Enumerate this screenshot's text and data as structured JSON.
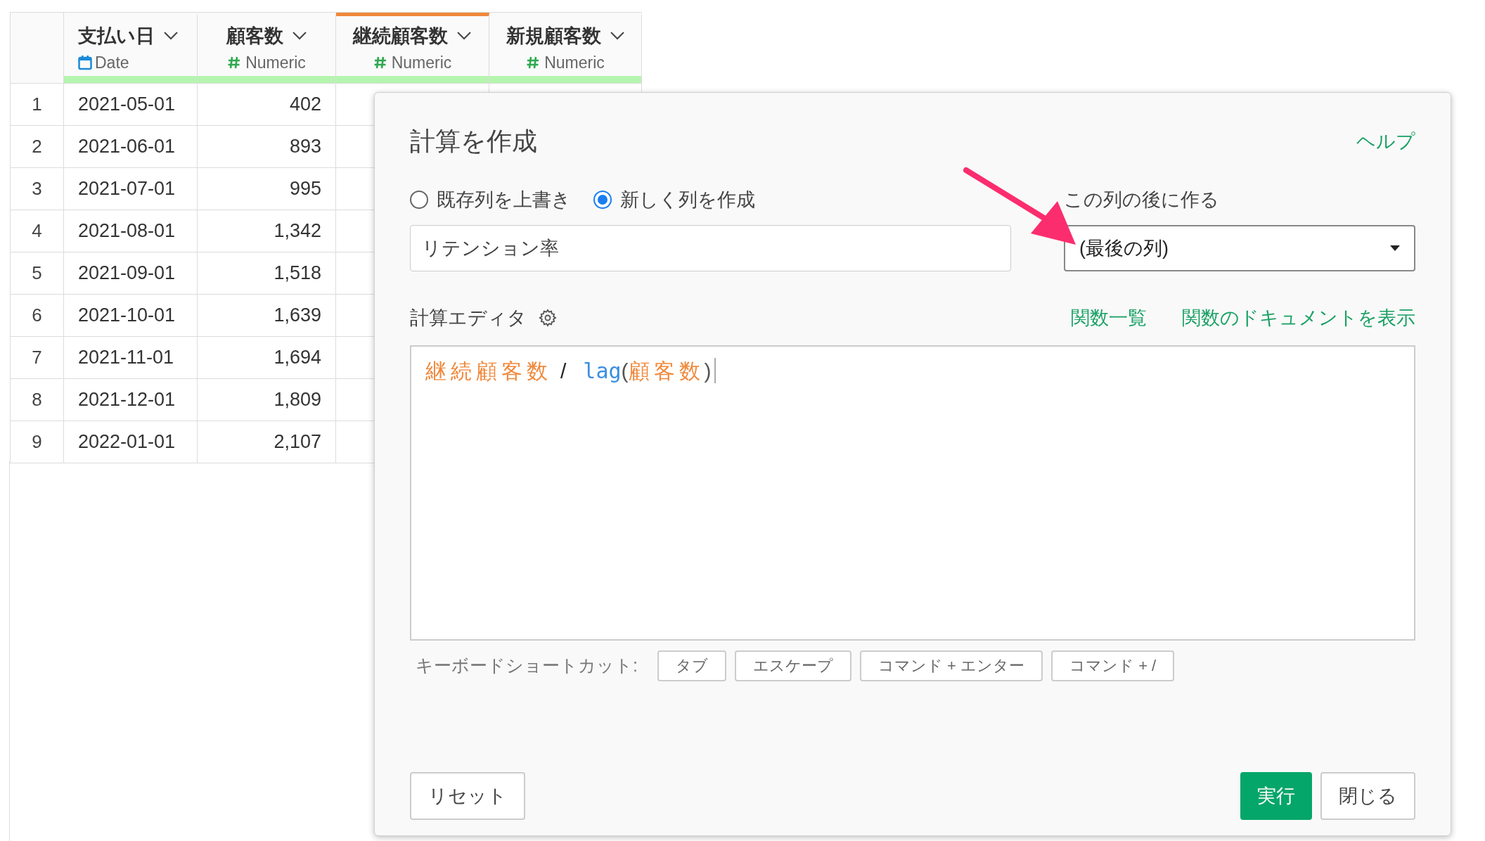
{
  "table": {
    "columns": [
      {
        "name": "支払い日",
        "type": "Date",
        "kind": "date",
        "selected": false
      },
      {
        "name": "顧客数",
        "type": "Numeric",
        "kind": "numeric",
        "selected": false
      },
      {
        "name": "継続顧客数",
        "type": "Numeric",
        "kind": "numeric",
        "selected": true
      },
      {
        "name": "新規顧客数",
        "type": "Numeric",
        "kind": "numeric",
        "selected": false
      }
    ],
    "rows": [
      {
        "number": "1",
        "cells": [
          "2021-05-01",
          "402"
        ]
      },
      {
        "number": "2",
        "cells": [
          "2021-06-01",
          "893"
        ]
      },
      {
        "number": "3",
        "cells": [
          "2021-07-01",
          "995"
        ]
      },
      {
        "number": "4",
        "cells": [
          "2021-08-01",
          "1,342"
        ]
      },
      {
        "number": "5",
        "cells": [
          "2021-09-01",
          "1,518"
        ]
      },
      {
        "number": "6",
        "cells": [
          "2021-10-01",
          "1,639"
        ]
      },
      {
        "number": "7",
        "cells": [
          "2021-11-01",
          "1,694"
        ]
      },
      {
        "number": "8",
        "cells": [
          "2021-12-01",
          "1,809"
        ]
      },
      {
        "number": "9",
        "cells": [
          "2022-01-01",
          "2,107"
        ]
      }
    ]
  },
  "dialog": {
    "title": "計算を作成",
    "help_link": "ヘルプ",
    "modes": [
      {
        "label": "既存列を上書き",
        "selected": false
      },
      {
        "label": "新しく列を作成",
        "selected": true
      }
    ],
    "column_name": {
      "value": "リテンション率"
    },
    "position": {
      "label": "この列の後に作る",
      "value": "(最後の列)"
    },
    "editor": {
      "label": "計算エディタ",
      "links": [
        "関数一覧",
        "関数のドキュメントを表示"
      ],
      "tokens": [
        {
          "kind": "column",
          "text": "継続顧客数"
        },
        {
          "kind": "operator",
          "text": "/"
        },
        {
          "kind": "function",
          "text": "lag"
        },
        {
          "kind": "paren",
          "text": "("
        },
        {
          "kind": "column",
          "text": "顧客数"
        },
        {
          "kind": "paren",
          "text": ")"
        }
      ]
    },
    "shortcuts": {
      "label": "キーボードショートカット:",
      "keys": [
        "タブ",
        "エスケープ",
        "コマンド + エンター",
        "コマンド + /"
      ]
    },
    "buttons": {
      "reset": "リセット",
      "run": "実行",
      "close": "閉じる"
    }
  }
}
